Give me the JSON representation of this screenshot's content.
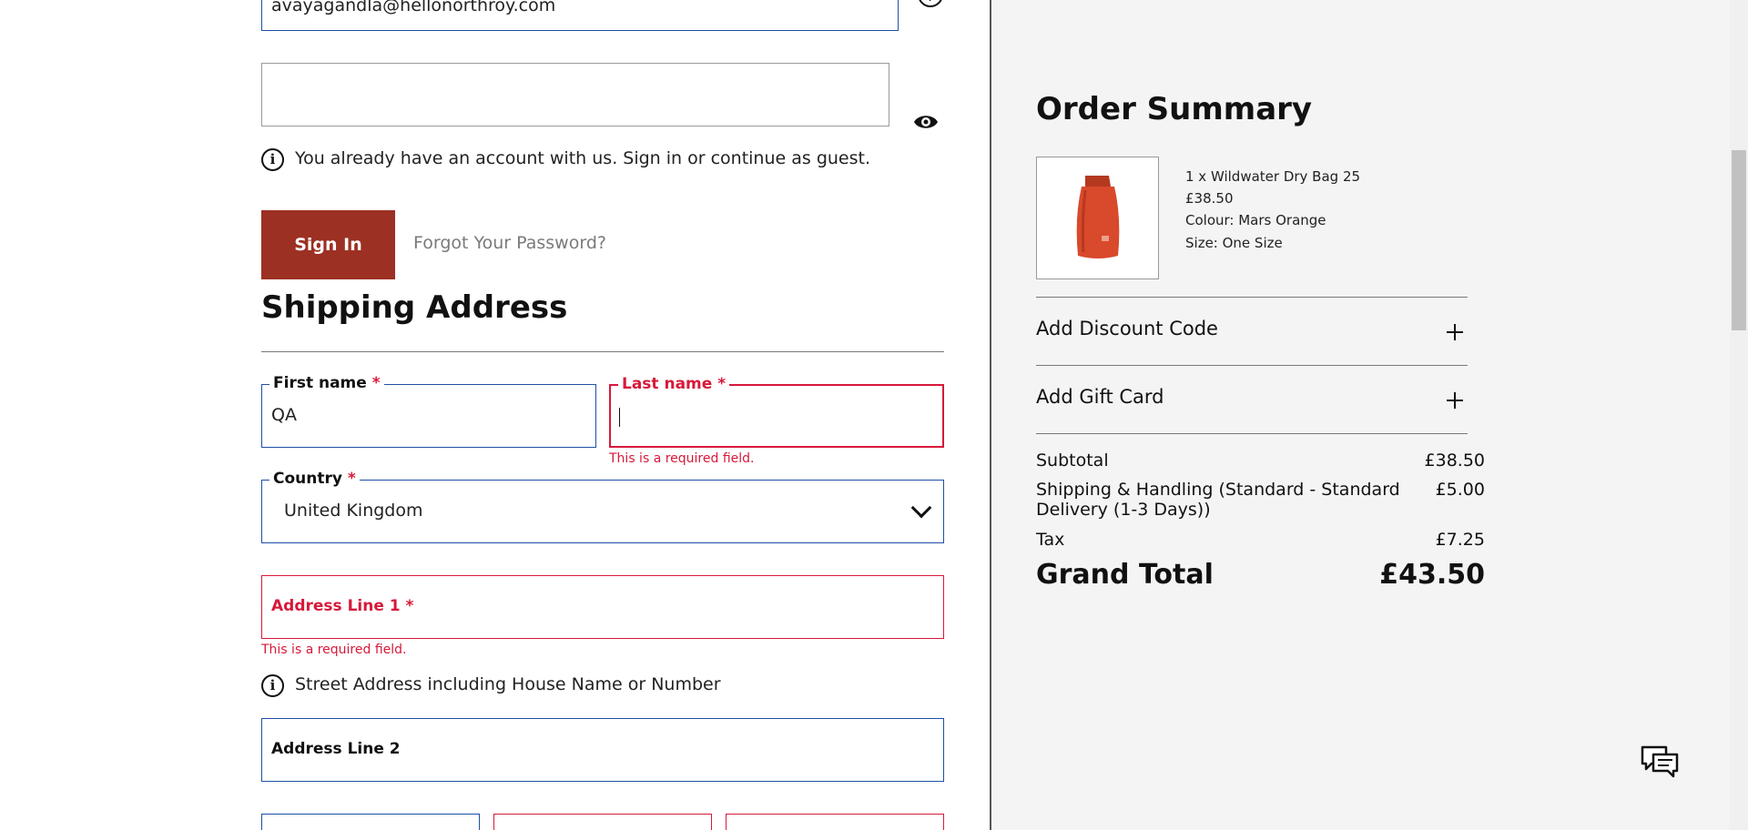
{
  "login": {
    "email_value": "avayagandla@hellonorthroy.com",
    "password_value": "",
    "account_notice": "You already have an account with us. Sign in or continue as guest.",
    "signin_label": "Sign In",
    "forgot_label": "Forgot Your Password?"
  },
  "shipping": {
    "title": "Shipping Address",
    "first_name_label": "First name",
    "first_name_value": "QA",
    "last_name_label": "Last name",
    "last_name_value": "",
    "required_marker": "*",
    "required_error": "This is a required field.",
    "country_label": "Country",
    "country_value": "United Kingdom",
    "address1_label": "Address Line 1",
    "address1_error": "This is a required field.",
    "address1_hint": "Street Address including House Name or Number",
    "address2_label": "Address Line 2"
  },
  "summary": {
    "title": "Order Summary",
    "item": {
      "name_line": "1 x Wildwater Dry Bag 25",
      "price": "£38.50",
      "colour": "Colour: Mars Orange",
      "size": "Size: One Size"
    },
    "discount_label": "Add Discount Code",
    "gift_label": "Add Gift Card",
    "subtotal_label": "Subtotal",
    "subtotal_value": "£38.50",
    "shipping_label_1": "Shipping & Handling (Standard - Standard",
    "shipping_label_2": "Delivery (1-3 Days))",
    "shipping_value": "£5.00",
    "tax_label": "Tax",
    "tax_value": "£7.25",
    "grand_label": "Grand Total",
    "grand_value": "£43.50"
  },
  "colors": {
    "brand_button": "#9c3022",
    "field_border": "#1e4fa8",
    "error": "#d7193a",
    "summary_bg": "#f4f4f4"
  },
  "icons": [
    "help-icon",
    "eye-icon",
    "info-icon",
    "chevron-down-icon",
    "plus-icon",
    "chat-icon"
  ]
}
